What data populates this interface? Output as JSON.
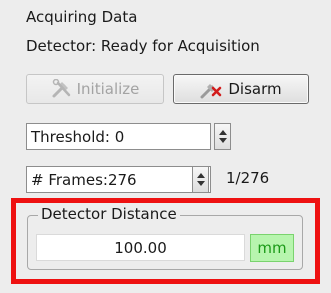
{
  "status": {
    "acquiring": "Acquiring Data",
    "detector": "Detector: Ready for Acquisition"
  },
  "buttons": {
    "initialize": {
      "label": "Initialize",
      "icon": "wrench-hammer-icon",
      "enabled": false
    },
    "disarm": {
      "label": "Disarm",
      "icon": "disarm-icon"
    }
  },
  "threshold": {
    "value": "Threshold: 0"
  },
  "frames": {
    "value": "# Frames:276",
    "count": "1/276"
  },
  "detector_distance": {
    "title": "Detector Distance",
    "value": "100.00",
    "unit": "mm",
    "highlight_color": "#ee1111",
    "unit_bg_color": "#b7f5ae"
  }
}
